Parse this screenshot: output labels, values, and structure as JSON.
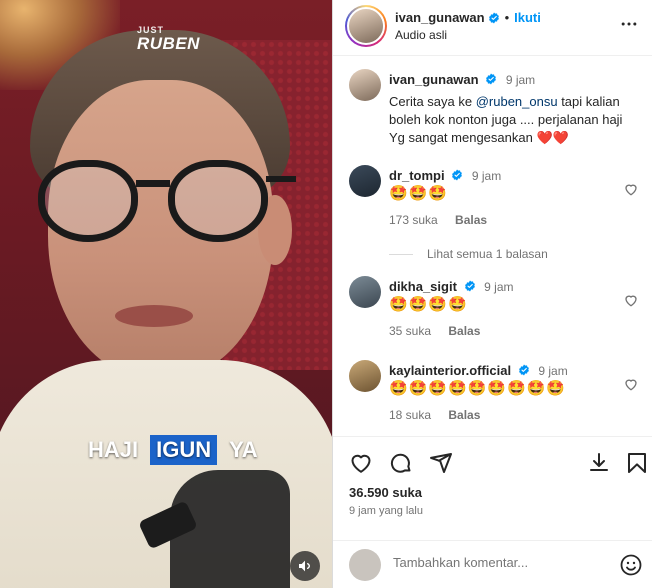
{
  "video": {
    "brand_top": "JUST",
    "brand_bottom": "RUBEN",
    "caption_1": "HAJI",
    "caption_2": "IGUN",
    "caption_3": "YA"
  },
  "header": {
    "username": "ivan_gunawan",
    "separator": "•",
    "follow_label": "Ikuti",
    "audio_label": "Audio asli"
  },
  "comments": [
    {
      "username": "ivan_gunawan",
      "time": "9 jam",
      "text_pre": "Cerita saya ke ",
      "mention": "@ruben_onsu",
      "text_post": " tapi kalian boleh kok nonton juga .... perjalanan haji Yg sangat mengesankan ",
      "emoji": "❤️❤️"
    },
    {
      "username": "dr_tompi",
      "time": "9 jam",
      "text": "🤩🤩🤩",
      "likes": "173 suka",
      "reply": "Balas"
    },
    {
      "username": "dikha_sigit",
      "time": "9 jam",
      "text": "🤩🤩🤩🤩",
      "likes": "35 suka",
      "reply": "Balas"
    },
    {
      "username": "kaylainterior.official",
      "time": "9 jam",
      "text": "🤩🤩🤩🤩🤩🤩🤩🤩🤩",
      "likes": "18 suka",
      "reply": "Balas"
    }
  ],
  "view_replies": "Lihat semua 1 balasan",
  "footer": {
    "likes": "36.590 suka",
    "time_ago": "9 jam yang lalu",
    "comment_placeholder": "Tambahkan komentar..."
  },
  "icons": {
    "verified": "verified-badge-icon",
    "heart": "heart-icon",
    "comment": "comment-icon",
    "share": "share-icon",
    "download": "download-icon",
    "save": "bookmark-icon",
    "more": "more-options-icon",
    "emoji": "emoji-icon",
    "sound": "speaker-icon"
  },
  "colors": {
    "accent": "#0095f6",
    "caption_highlight": "#1b63c9",
    "heart": "#e0245e"
  }
}
